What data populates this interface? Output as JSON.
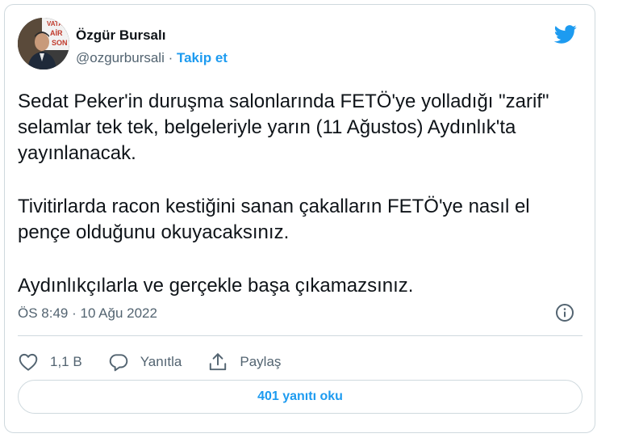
{
  "author": {
    "name": "Özgür Bursalı",
    "handle": "@ozgurbursali",
    "separator": " · ",
    "follow_label": "Takip et",
    "avatar_sign_text": "VATAN\nAİR\nSON"
  },
  "tweet": {
    "paragraphs": [
      "Sedat Peker'in duruşma salonlarında FETÖ'ye yolladığı \"zarif\" selamlar tek tek, belgeleriyle yarın (11 Ağustos) Aydınlık'ta yayınlanacak.",
      "Tivitirlarda racon kestiğini sanan çakalların FETÖ'ye nasıl el pençe olduğunu okuyacaksınız.",
      "Aydınlıkçılarla ve gerçekle başa çıkamazsınız."
    ],
    "time": "ÖS 8:49",
    "date_separator": " · ",
    "date": "10 Ağu 2022"
  },
  "actions": {
    "like_count": "1,1 B",
    "reply_label": "Yanıtla",
    "share_label": "Paylaş"
  },
  "read_replies_label": "401 yanıtı oku",
  "colors": {
    "accent": "#1d9bf0",
    "text": "#0f1419",
    "muted": "#536471",
    "border": "#cfd9de"
  },
  "icons": {
    "brand": "twitter-bird-icon",
    "info": "info-icon",
    "like": "heart-icon",
    "reply": "speech-bubble-icon",
    "share": "share-upload-icon"
  }
}
